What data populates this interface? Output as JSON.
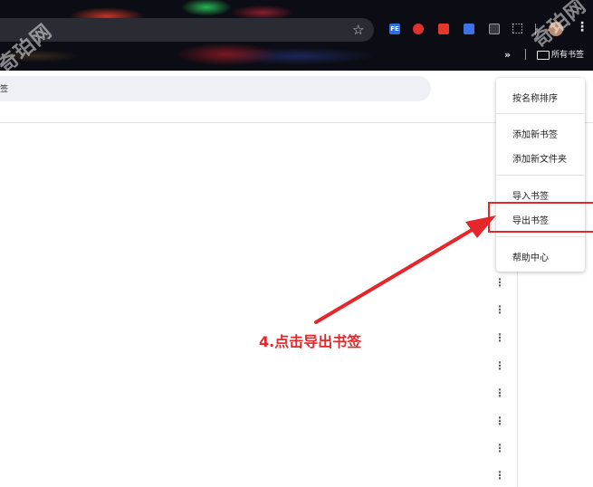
{
  "browser": {
    "extensions": [
      {
        "name": "fe-extension-icon",
        "label": "FE"
      },
      {
        "name": "red-extension-icon",
        "label": ""
      },
      {
        "name": "pen-extension-icon",
        "label": ""
      },
      {
        "name": "blue-extension-icon",
        "label": ""
      },
      {
        "name": "window-extension-icon",
        "label": ""
      }
    ],
    "bookmarks_bar": {
      "overflow": "»",
      "all_bookmarks": "所有书签"
    }
  },
  "manager": {
    "search_text": "签"
  },
  "menu": {
    "items": [
      {
        "label": "按名称排序"
      },
      {
        "label": "添加新书签"
      },
      {
        "label": "添加新文件夹"
      },
      {
        "label": "导入书签"
      },
      {
        "label": "导出书签"
      },
      {
        "label": "帮助中心"
      }
    ],
    "highlighted": "导出书签"
  },
  "annotation": {
    "text": "4.点击导出书签",
    "color": "#e5262a"
  },
  "watermark": "奇珀网"
}
